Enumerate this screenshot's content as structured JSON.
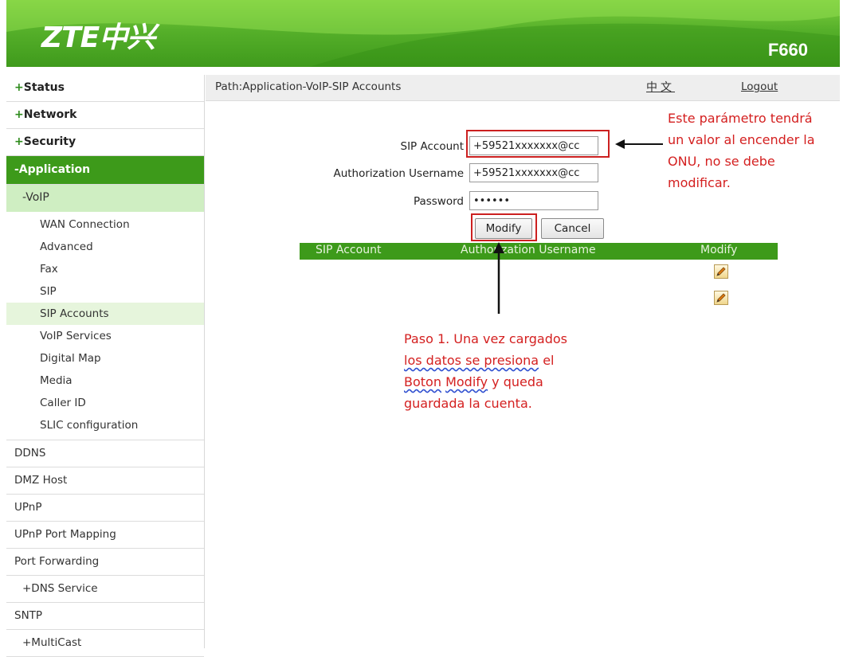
{
  "header": {
    "logo_text": "ZTE中兴",
    "model": "F660"
  },
  "sidebar": {
    "top_items": [
      {
        "prefix": "+",
        "label": "Status"
      },
      {
        "prefix": "+",
        "label": "Network"
      },
      {
        "prefix": "+",
        "label": "Security"
      }
    ],
    "application": {
      "label": "-Application"
    },
    "voip": {
      "label": "-VoIP"
    },
    "voip_items": [
      "WAN Connection",
      "Advanced",
      "Fax",
      "SIP",
      "SIP Accounts",
      "VoIP Services",
      "Digital Map",
      "Media",
      "Caller ID",
      "SLIC configuration"
    ],
    "voip_selected": "SIP Accounts",
    "lower_items": {
      "ddns": "DDNS",
      "dmz": "DMZ Host",
      "upnp": "UPnP",
      "upnp_port": "UPnP Port Mapping",
      "port_forwarding": "Port Forwarding",
      "dns_service": "+DNS Service",
      "sntp": "SNTP",
      "multicast": "+MultiCast"
    }
  },
  "pathbar": {
    "path": "Path:Application-VoIP-SIP Accounts",
    "language": "中文",
    "logout": "Logout"
  },
  "form": {
    "sip_account_label": "SIP Account",
    "sip_account_value": "+59521xxxxxxx@cc",
    "auth_username_label": "Authorization Username",
    "auth_username_value": "+59521xxxxxxx@cc",
    "password_label": "Password",
    "password_value": "••••••",
    "modify_button": "Modify",
    "cancel_button": "Cancel"
  },
  "table": {
    "columns": [
      "SIP Account",
      "Authorization Username",
      "Modify"
    ],
    "row_count_icons": 2
  },
  "annotations": {
    "note1": [
      "Este parámetro tendrá",
      "un valor al encender la",
      "ONU, no se debe",
      "modificar."
    ],
    "note2_line1": "Paso 1. Una vez cargados",
    "note2_line2_squiggle": "los datos se presiona",
    "note2_line2_rest": " el",
    "note2_line3_s1": "Boton",
    "note2_line3_sep": " ",
    "note2_line3_s2": "Modify",
    "note2_line3_rest": " y queda",
    "note2_line4": "guardada la cuenta.",
    "color": "#d42020"
  },
  "colors": {
    "brand_green": "#3d9a1a",
    "light_green": "#cfeec2",
    "highlight_red": "#cc2020"
  }
}
